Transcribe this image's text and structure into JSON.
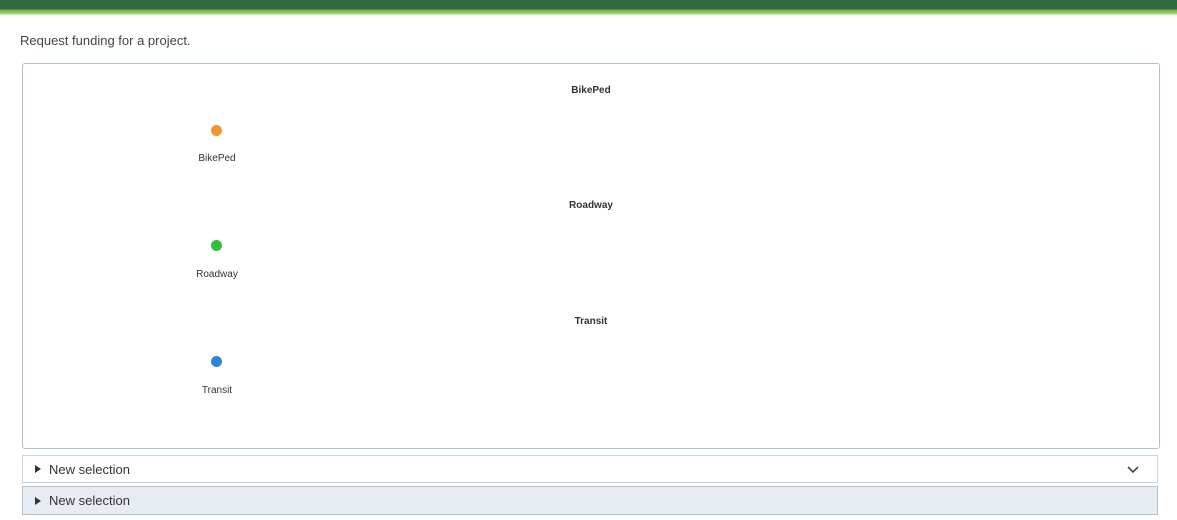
{
  "header": {
    "prompt": "Request funding for a project."
  },
  "categories": [
    {
      "title": "BikePed",
      "label": "BikePed",
      "color": "#f0952f"
    },
    {
      "title": "Roadway",
      "label": "Roadway",
      "color": "#2fbf3a"
    },
    {
      "title": "Transit",
      "label": "Transit",
      "color": "#2b86d6"
    }
  ],
  "selections": [
    {
      "label": "New selection"
    },
    {
      "label": "New selection"
    }
  ]
}
